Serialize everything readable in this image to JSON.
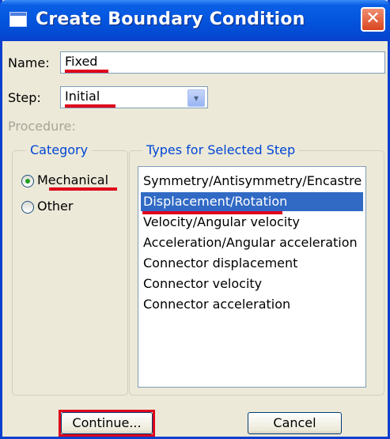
{
  "window": {
    "title": "Create Boundary Condition",
    "close_glyph": "✕"
  },
  "name_field": {
    "label": "Name:",
    "value": "Fixed"
  },
  "step_field": {
    "label": "Step:",
    "value": "Initial",
    "dropdown_glyph": "▾"
  },
  "procedure": {
    "label": "Procedure:"
  },
  "category": {
    "legend": "Category",
    "options": [
      {
        "label": "Mechanical",
        "selected": true
      },
      {
        "label": "Other",
        "selected": false
      }
    ]
  },
  "types": {
    "legend": "Types for Selected Step",
    "items": [
      "Symmetry/Antisymmetry/Encastre",
      "Displacement/Rotation",
      "Velocity/Angular velocity",
      "Acceleration/Angular acceleration",
      "Connector displacement",
      "Connector velocity",
      "Connector acceleration"
    ],
    "selected_index": 1
  },
  "buttons": {
    "continue": "Continue...",
    "cancel": "Cancel"
  },
  "colors": {
    "annotation_red": "#e0001a",
    "selection_blue": "#316ac5",
    "title_blue": "#0455de"
  }
}
